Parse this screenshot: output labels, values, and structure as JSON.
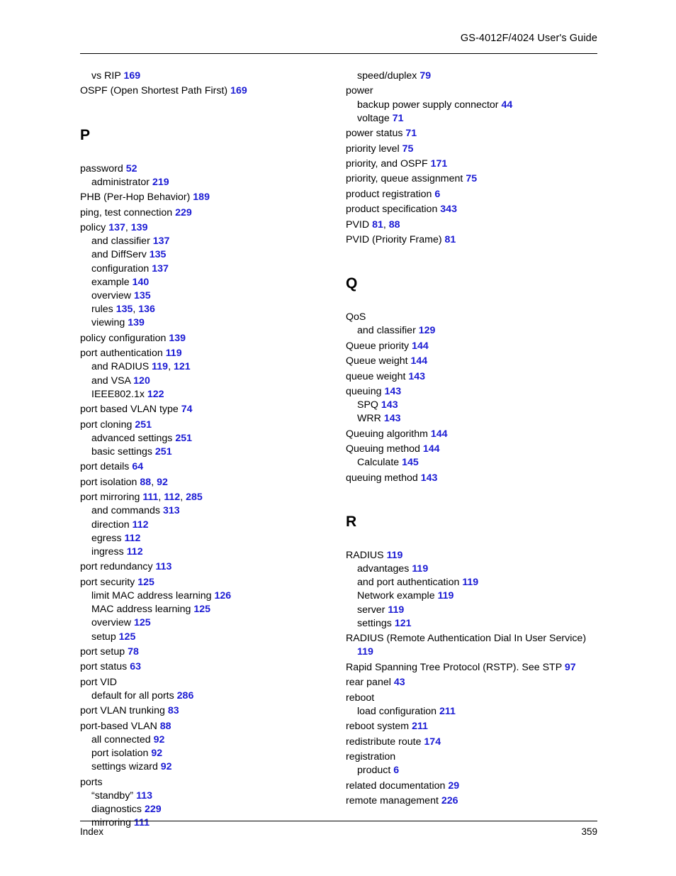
{
  "header": {
    "title": "GS-4012F/4024 User's Guide"
  },
  "footer": {
    "label": "Index",
    "page_number": "359"
  },
  "colors": {
    "page_number": "#1b1bd4",
    "text": "#000000",
    "rule": "#000000"
  },
  "columns": [
    {
      "name": "left-column",
      "blocks": [
        {
          "type": "entries",
          "items": [
            {
              "level": 1,
              "text": "vs RIP",
              "pages": "169"
            },
            {
              "level": 0,
              "text": "OSPF (Open Shortest Path First)",
              "pages": "169"
            }
          ]
        },
        {
          "type": "letter",
          "letter": "P"
        },
        {
          "type": "entries",
          "items": [
            {
              "level": 0,
              "text": "password",
              "pages": "52"
            },
            {
              "level": 1,
              "text": "administrator",
              "pages": "219"
            },
            {
              "level": 0,
              "text": "PHB (Per-Hop Behavior)",
              "pages": "189"
            },
            {
              "level": 0,
              "text": "ping, test connection",
              "pages": "229"
            },
            {
              "level": 0,
              "text": "policy",
              "pages": "137, 139"
            },
            {
              "level": 1,
              "text": "and classifier",
              "pages": "137"
            },
            {
              "level": 1,
              "text": "and DiffServ",
              "pages": "135"
            },
            {
              "level": 1,
              "text": "configuration",
              "pages": "137"
            },
            {
              "level": 1,
              "text": "example",
              "pages": "140"
            },
            {
              "level": 1,
              "text": "overview",
              "pages": "135"
            },
            {
              "level": 1,
              "text": "rules",
              "pages": "135, 136"
            },
            {
              "level": 1,
              "text": "viewing",
              "pages": "139"
            },
            {
              "level": 0,
              "text": "policy configuration",
              "pages": "139"
            },
            {
              "level": 0,
              "text": "port authentication",
              "pages": "119"
            },
            {
              "level": 1,
              "text": "and RADIUS",
              "pages": "119, 121"
            },
            {
              "level": 1,
              "text": "and VSA",
              "pages": "120"
            },
            {
              "level": 1,
              "text": "IEEE802.1x",
              "pages": "122"
            },
            {
              "level": 0,
              "text": "port based VLAN type",
              "pages": "74"
            },
            {
              "level": 0,
              "text": "port cloning",
              "pages": "251"
            },
            {
              "level": 1,
              "text": "advanced settings",
              "pages": "251"
            },
            {
              "level": 1,
              "text": "basic settings",
              "pages": "251"
            },
            {
              "level": 0,
              "text": "port details",
              "pages": "64"
            },
            {
              "level": 0,
              "text": "port isolation",
              "pages": "88, 92"
            },
            {
              "level": 0,
              "text": "port mirroring",
              "pages": "111, 112, 285"
            },
            {
              "level": 1,
              "text": "and commands",
              "pages": "313"
            },
            {
              "level": 1,
              "text": "direction",
              "pages": "112"
            },
            {
              "level": 1,
              "text": "egress",
              "pages": "112"
            },
            {
              "level": 1,
              "text": "ingress",
              "pages": "112"
            },
            {
              "level": 0,
              "text": "port redundancy",
              "pages": "113"
            },
            {
              "level": 0,
              "text": "port security",
              "pages": "125"
            },
            {
              "level": 1,
              "text": "limit MAC address learning",
              "pages": "126"
            },
            {
              "level": 1,
              "text": "MAC address learning",
              "pages": "125"
            },
            {
              "level": 1,
              "text": "overview",
              "pages": "125"
            },
            {
              "level": 1,
              "text": "setup",
              "pages": "125"
            },
            {
              "level": 0,
              "text": "port setup",
              "pages": "78"
            },
            {
              "level": 0,
              "text": "port status",
              "pages": "63"
            },
            {
              "level": 0,
              "text": "port VID",
              "pages": ""
            },
            {
              "level": 1,
              "text": "default for all ports",
              "pages": "286"
            },
            {
              "level": 0,
              "text": "port VLAN trunking",
              "pages": "83"
            },
            {
              "level": 0,
              "text": "port-based VLAN",
              "pages": "88"
            },
            {
              "level": 1,
              "text": "all connected",
              "pages": "92"
            },
            {
              "level": 1,
              "text": "port isolation",
              "pages": "92"
            },
            {
              "level": 1,
              "text": "settings wizard",
              "pages": "92"
            },
            {
              "level": 0,
              "text": "ports",
              "pages": ""
            },
            {
              "level": 1,
              "text": "“standby”",
              "pages": "113"
            },
            {
              "level": 1,
              "text": "diagnostics",
              "pages": "229"
            },
            {
              "level": 1,
              "text": "mirroring",
              "pages": "111"
            }
          ]
        }
      ]
    },
    {
      "name": "right-column",
      "blocks": [
        {
          "type": "entries",
          "items": [
            {
              "level": 1,
              "text": "speed/duplex",
              "pages": "79"
            },
            {
              "level": 0,
              "text": "power",
              "pages": ""
            },
            {
              "level": 1,
              "text": "backup power supply connector",
              "pages": "44"
            },
            {
              "level": 1,
              "text": "voltage",
              "pages": "71"
            },
            {
              "level": 0,
              "text": "power status",
              "pages": "71"
            },
            {
              "level": 0,
              "text": "priority level",
              "pages": "75"
            },
            {
              "level": 0,
              "text": "priority, and OSPF",
              "pages": "171"
            },
            {
              "level": 0,
              "text": "priority, queue assignment",
              "pages": "75"
            },
            {
              "level": 0,
              "text": "product registration",
              "pages": "6"
            },
            {
              "level": 0,
              "text": "product specification",
              "pages": "343"
            },
            {
              "level": 0,
              "text": "PVID",
              "pages": "81, 88"
            },
            {
              "level": 0,
              "text": "PVID (Priority Frame)",
              "pages": "81"
            }
          ]
        },
        {
          "type": "letter",
          "letter": "Q"
        },
        {
          "type": "entries",
          "items": [
            {
              "level": 0,
              "text": "QoS",
              "pages": ""
            },
            {
              "level": 1,
              "text": "and classifier",
              "pages": "129"
            },
            {
              "level": 0,
              "text": "Queue priority",
              "pages": "144"
            },
            {
              "level": 0,
              "text": "Queue weight",
              "pages": "144"
            },
            {
              "level": 0,
              "text": "queue weight",
              "pages": "143"
            },
            {
              "level": 0,
              "text": "queuing",
              "pages": "143"
            },
            {
              "level": 1,
              "text": "SPQ",
              "pages": "143"
            },
            {
              "level": 1,
              "text": "WRR",
              "pages": "143"
            },
            {
              "level": 0,
              "text": "Queuing algorithm",
              "pages": "144"
            },
            {
              "level": 0,
              "text": "Queuing method",
              "pages": "144"
            },
            {
              "level": 1,
              "text": "Calculate",
              "pages": "145"
            },
            {
              "level": 0,
              "text": "queuing method",
              "pages": "143"
            }
          ]
        },
        {
          "type": "letter",
          "letter": "R"
        },
        {
          "type": "entries",
          "items": [
            {
              "level": 0,
              "text": "RADIUS",
              "pages": "119"
            },
            {
              "level": 1,
              "text": "advantages",
              "pages": "119"
            },
            {
              "level": 1,
              "text": "and port authentication",
              "pages": "119"
            },
            {
              "level": 1,
              "text": "Network example",
              "pages": "119"
            },
            {
              "level": 1,
              "text": "server",
              "pages": "119"
            },
            {
              "level": 1,
              "text": "settings",
              "pages": "121"
            },
            {
              "level": 0,
              "text": "RADIUS (Remote Authentication Dial In User Service)",
              "pages": "119"
            },
            {
              "level": 0,
              "text": "Rapid Spanning Tree Protocol (RSTP). See STP",
              "pages": "97"
            },
            {
              "level": 0,
              "text": "rear panel",
              "pages": "43"
            },
            {
              "level": 0,
              "text": "reboot",
              "pages": ""
            },
            {
              "level": 1,
              "text": "load configuration",
              "pages": "211"
            },
            {
              "level": 0,
              "text": "reboot system",
              "pages": "211"
            },
            {
              "level": 0,
              "text": "redistribute route",
              "pages": "174"
            },
            {
              "level": 0,
              "text": "registration",
              "pages": ""
            },
            {
              "level": 1,
              "text": "product",
              "pages": "6"
            },
            {
              "level": 0,
              "text": "related documentation",
              "pages": "29"
            },
            {
              "level": 0,
              "text": "remote management",
              "pages": "226"
            }
          ]
        }
      ]
    }
  ]
}
